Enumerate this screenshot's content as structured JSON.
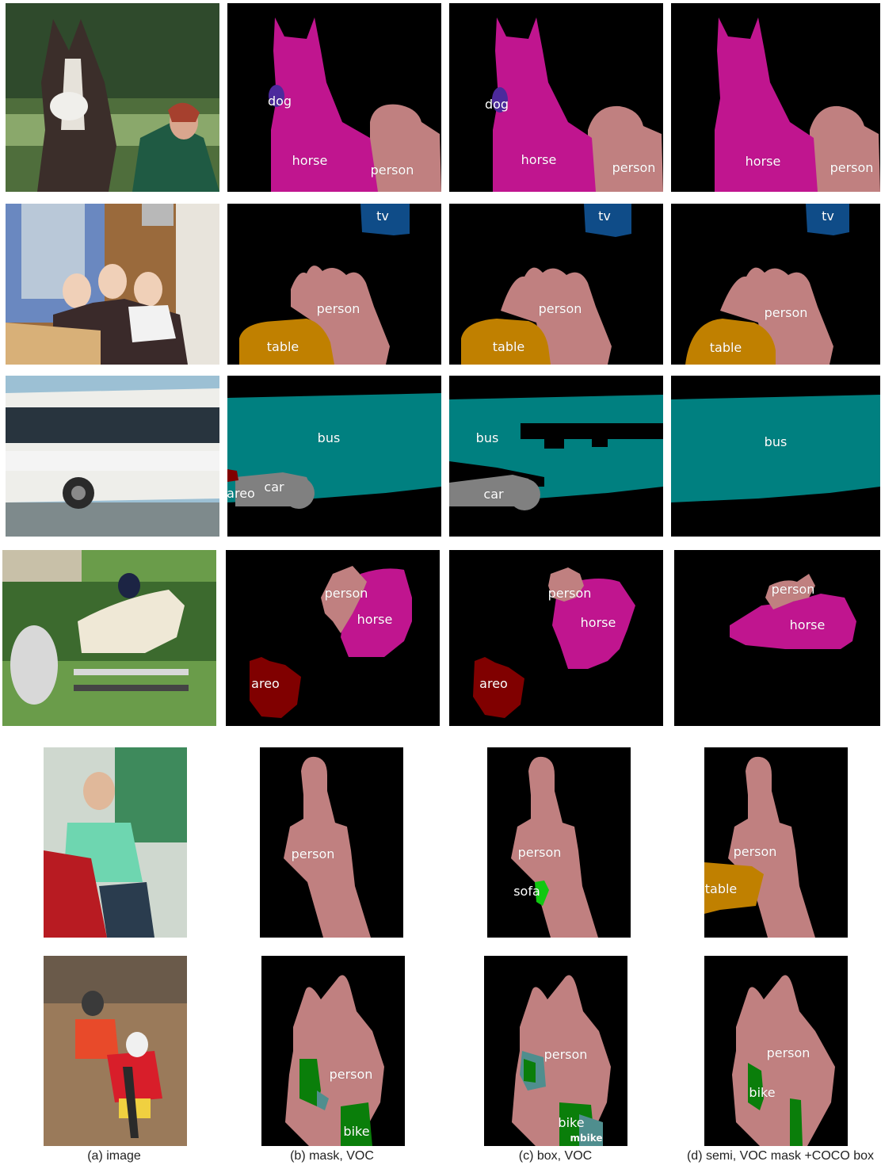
{
  "colors": {
    "background": "#000000",
    "person": "#c08080",
    "horse": "#c0158f",
    "dog": "#4c2a9c",
    "tv": "#0f4c88",
    "table": "#c08000",
    "bus": "#008080",
    "car": "#808080",
    "aeroplane": "#800000",
    "sofa": "#11c811",
    "bike": "#0a7e0a",
    "mbike": "#4f8e8e"
  },
  "rows": [
    {
      "name": "row-horse-person",
      "mask_b_labels": [
        "dog",
        "horse",
        "person"
      ],
      "box_c_labels": [
        "dog",
        "horse",
        "person"
      ],
      "semi_d_labels": [
        "horse",
        "person"
      ]
    },
    {
      "name": "row-indoor-group",
      "mask_b_labels": [
        "tv",
        "person",
        "table"
      ],
      "box_c_labels": [
        "tv",
        "person",
        "table"
      ],
      "semi_d_labels": [
        "tv",
        "person",
        "table"
      ]
    },
    {
      "name": "row-bus",
      "mask_b_labels": [
        "bus",
        "areo",
        "car"
      ],
      "box_c_labels": [
        "bus",
        "car"
      ],
      "semi_d_labels": [
        "bus"
      ]
    },
    {
      "name": "row-show-jumping",
      "mask_b_labels": [
        "person",
        "horse",
        "areo"
      ],
      "box_c_labels": [
        "person",
        "horse",
        "areo"
      ],
      "semi_d_labels": [
        "person",
        "horse"
      ]
    },
    {
      "name": "row-woman-window",
      "mask_b_labels": [
        "person"
      ],
      "box_c_labels": [
        "person",
        "sofa"
      ],
      "semi_d_labels": [
        "person",
        "table"
      ]
    },
    {
      "name": "row-cyclists",
      "mask_b_labels": [
        "person",
        "bike"
      ],
      "box_c_labels": [
        "person",
        "bike",
        "mbike"
      ],
      "semi_d_labels": [
        "person",
        "bike"
      ]
    }
  ],
  "captions": {
    "image": "(a) image",
    "mask": "(b) mask, VOC",
    "box": "(c) box, VOC",
    "semi": "(d) semi, VOC mask +COCO box"
  }
}
